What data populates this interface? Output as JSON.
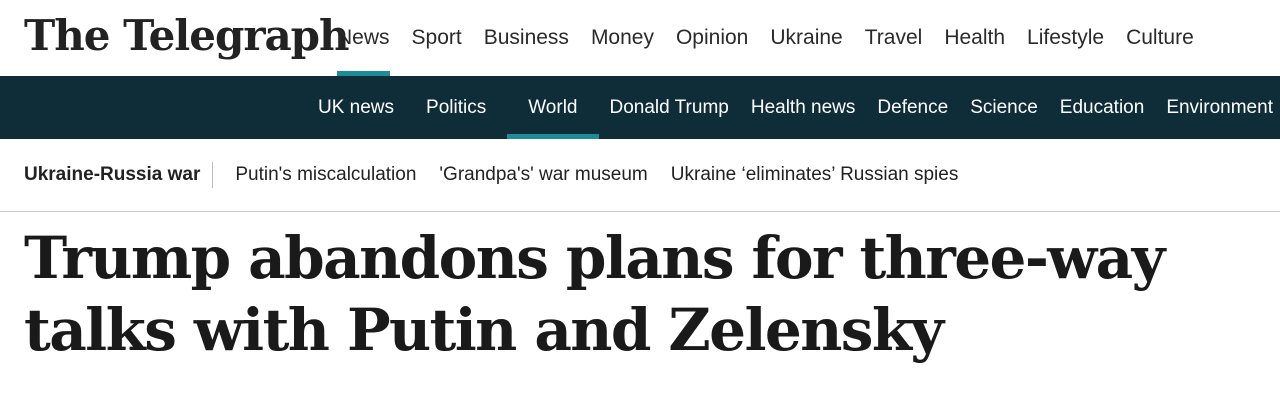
{
  "brand": {
    "logo_text": "The Telegraph"
  },
  "primary_nav": {
    "items": [
      {
        "label": "News",
        "active": true
      },
      {
        "label": "Sport"
      },
      {
        "label": "Business"
      },
      {
        "label": "Money"
      },
      {
        "label": "Opinion"
      },
      {
        "label": "Ukraine"
      },
      {
        "label": "Travel"
      },
      {
        "label": "Health"
      },
      {
        "label": "Lifestyle"
      },
      {
        "label": "Culture"
      }
    ]
  },
  "secondary_nav": {
    "items": [
      {
        "label": "UK news"
      },
      {
        "label": "Politics"
      },
      {
        "label": "World",
        "active": true
      },
      {
        "label": "Donald Trump"
      },
      {
        "label": "Health news"
      },
      {
        "label": "Defence"
      },
      {
        "label": "Science"
      },
      {
        "label": "Education"
      },
      {
        "label": "Environment"
      }
    ]
  },
  "topic_bar": {
    "title": "Ukraine-Russia war",
    "links": [
      "Putin's miscalculation",
      "'Grandpa's' war museum",
      "Ukraine ‘eliminates’ Russian spies"
    ]
  },
  "article": {
    "headline": "Trump abandons plans for three-way talks with Putin and Zelensky"
  },
  "colors": {
    "accent": "#1e8c98",
    "dark_bar": "#0f2c39"
  }
}
